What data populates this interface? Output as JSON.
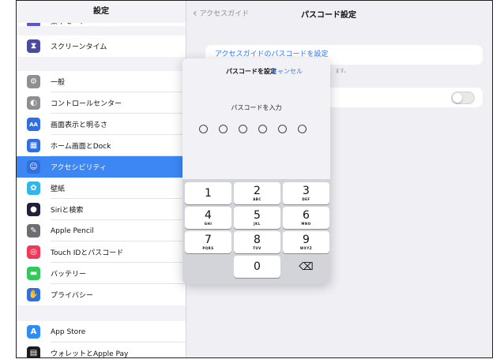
{
  "sidebar": {
    "title": "設定",
    "top_partial_label": "集中モード",
    "group1": [
      {
        "label": "スクリーンタイム",
        "icon": "hourglass-icon",
        "color": "#4a4a9e",
        "glyph": "⧗"
      }
    ],
    "group2": [
      {
        "label": "一般",
        "icon": "gear-icon",
        "color": "#8e8e93",
        "glyph": "⚙"
      },
      {
        "label": "コントロールセンター",
        "icon": "control-center-icon",
        "color": "#8e8e93",
        "glyph": "◐"
      },
      {
        "label": "画面表示と明るさ",
        "icon": "display-brightness-icon",
        "color": "#2f6fe0",
        "glyph": "AA"
      },
      {
        "label": "ホーム画面とDock",
        "icon": "home-screen-icon",
        "color": "#2f6fe0",
        "glyph": "▦"
      },
      {
        "label": "アクセシビリティ",
        "icon": "accessibility-icon",
        "color": "#2f6fe0",
        "glyph": "☺",
        "selected": true
      },
      {
        "label": "壁紙",
        "icon": "wallpaper-icon",
        "color": "#33b5e8",
        "glyph": "✿"
      },
      {
        "label": "Siriと検索",
        "icon": "siri-icon",
        "color": "#20203a",
        "glyph": "●"
      },
      {
        "label": "Apple Pencil",
        "icon": "pencil-icon",
        "color": "#6d6d72",
        "glyph": "✎"
      },
      {
        "label": "Touch IDとパスコード",
        "icon": "fingerprint-icon",
        "color": "#f2385a",
        "glyph": "◎"
      },
      {
        "label": "バッテリー",
        "icon": "battery-icon",
        "color": "#34c759",
        "glyph": "▬"
      },
      {
        "label": "プライバシー",
        "icon": "hand-icon",
        "color": "#2f6fe0",
        "glyph": "✋"
      }
    ],
    "group3": [
      {
        "label": "App Store",
        "icon": "app-store-icon",
        "color": "#2f8cf5",
        "glyph": "A"
      },
      {
        "label": "ウォレットとApple Pay",
        "icon": "wallet-icon",
        "color": "#1c1c1e",
        "glyph": "▤"
      }
    ]
  },
  "pane": {
    "back_label": "アクセスガイド",
    "title": "パスコード設定",
    "link_label": "アクセスガイドのパスコードを設定",
    "footer_note": "ます。"
  },
  "passcode": {
    "title": "パスコードを設定",
    "cancel": "キャンセル",
    "prompt": "パスコードを入力",
    "dots": 6,
    "keys": [
      {
        "num": "1",
        "sub": ""
      },
      {
        "num": "2",
        "sub": "ABC"
      },
      {
        "num": "3",
        "sub": "DEF"
      },
      {
        "num": "4",
        "sub": "GHI"
      },
      {
        "num": "5",
        "sub": "JKL"
      },
      {
        "num": "6",
        "sub": "MNO"
      },
      {
        "num": "7",
        "sub": "PQRS"
      },
      {
        "num": "8",
        "sub": "TUV"
      },
      {
        "num": "9",
        "sub": "WXYZ"
      }
    ],
    "zero": "0",
    "delete_glyph": "⌫"
  }
}
